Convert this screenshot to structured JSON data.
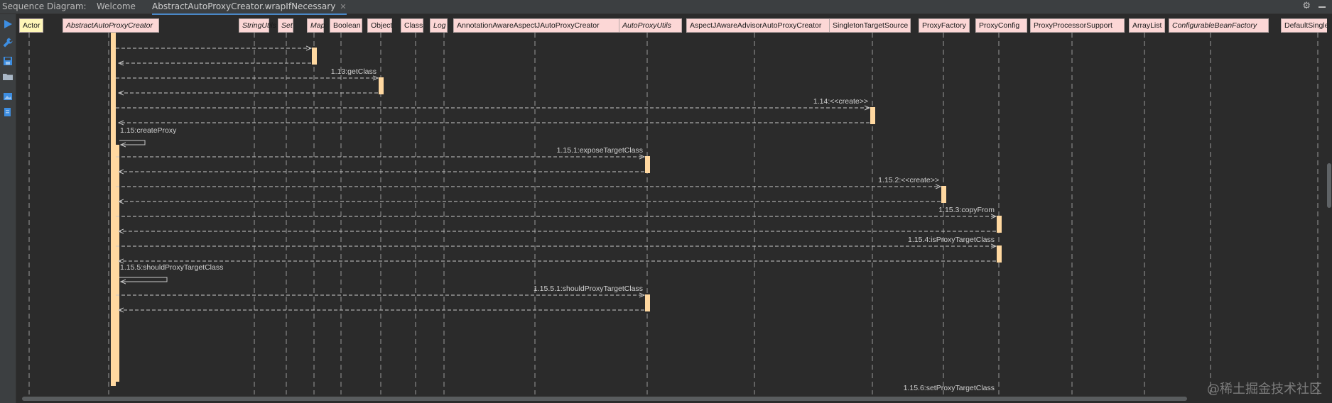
{
  "window": {
    "panel_title": "Sequence Diagram:",
    "tabs": [
      {
        "label": "Welcome",
        "active": false
      },
      {
        "label": "AbstractAutoProxyCreator.wrapIfNecessary",
        "active": true
      }
    ]
  },
  "toolbar_icons": [
    "play-icon",
    "wrench-icon",
    "save-icon",
    "folder-icon",
    "image-icon",
    "export-icon"
  ],
  "colors": {
    "background": "#2b2b2b",
    "lifeline_head": "#fcd7d6",
    "actor_head": "#fff7b8",
    "activation": "#ffd8a0",
    "tab_accent": "#4a88c7"
  },
  "lifelines": [
    {
      "name": "Actor",
      "italic": false
    },
    {
      "name": "AbstractAutoProxyCreator",
      "italic": true
    },
    {
      "name": "StringUtils",
      "italic": true
    },
    {
      "name": "Set",
      "italic": true
    },
    {
      "name": "Map",
      "italic": true
    },
    {
      "name": "Boolean",
      "italic": false
    },
    {
      "name": "Object",
      "italic": false
    },
    {
      "name": "Class",
      "italic": false
    },
    {
      "name": "Log",
      "italic": true
    },
    {
      "name": "AnnotationAwareAspectJAutoProxyCreator",
      "italic": false
    },
    {
      "name": "AutoProxyUtils",
      "italic": true
    },
    {
      "name": "AspectJAwareAdvisorAutoProxyCreator",
      "italic": false
    },
    {
      "name": "SingletonTargetSource",
      "italic": false
    },
    {
      "name": "ProxyFactory",
      "italic": false
    },
    {
      "name": "ProxyConfig",
      "italic": false
    },
    {
      "name": "ProxyProcessorSupport",
      "italic": false
    },
    {
      "name": "ArrayList",
      "italic": false
    },
    {
      "name": "ConfigurableBeanFactory",
      "italic": true
    },
    {
      "name": "DefaultSingle",
      "italic": false
    }
  ],
  "messages": [
    {
      "label": "",
      "from": "AbstractAutoProxyCreator",
      "to": "Map",
      "kind": "call"
    },
    {
      "label": "",
      "from": "Map",
      "to": "AbstractAutoProxyCreator",
      "kind": "return"
    },
    {
      "label": "1.13:getClass",
      "from": "AbstractAutoProxyCreator",
      "to": "Object",
      "kind": "call"
    },
    {
      "label": "",
      "from": "Object",
      "to": "AbstractAutoProxyCreator",
      "kind": "return"
    },
    {
      "label": "1.14:<<create>>",
      "from": "AbstractAutoProxyCreator",
      "to": "SingletonTargetSource",
      "kind": "call"
    },
    {
      "label": "",
      "from": "SingletonTargetSource",
      "to": "AbstractAutoProxyCreator",
      "kind": "return"
    },
    {
      "label": "1.15:createProxy",
      "from": "AbstractAutoProxyCreator",
      "to": "AbstractAutoProxyCreator",
      "kind": "self"
    },
    {
      "label": "1.15.1:exposeTargetClass",
      "from": "AbstractAutoProxyCreator",
      "to": "AutoProxyUtils",
      "kind": "call"
    },
    {
      "label": "",
      "from": "AutoProxyUtils",
      "to": "AbstractAutoProxyCreator",
      "kind": "return"
    },
    {
      "label": "1.15.2:<<create>>",
      "from": "AbstractAutoProxyCreator",
      "to": "ProxyFactory",
      "kind": "call"
    },
    {
      "label": "",
      "from": "ProxyFactory",
      "to": "AbstractAutoProxyCreator",
      "kind": "return"
    },
    {
      "label": "1.15.3:copyFrom",
      "from": "AbstractAutoProxyCreator",
      "to": "ProxyConfig",
      "kind": "call"
    },
    {
      "label": "",
      "from": "ProxyConfig",
      "to": "AbstractAutoProxyCreator",
      "kind": "return"
    },
    {
      "label": "1.15.4:isProxyTargetClass",
      "from": "AbstractAutoProxyCreator",
      "to": "ProxyConfig",
      "kind": "call"
    },
    {
      "label": "",
      "from": "ProxyConfig",
      "to": "AbstractAutoProxyCreator",
      "kind": "return"
    },
    {
      "label": "1.15.5:shouldProxyTargetClass",
      "from": "AbstractAutoProxyCreator",
      "to": "AbstractAutoProxyCreator",
      "kind": "self"
    },
    {
      "label": "1.15.5.1:shouldProxyTargetClass",
      "from": "AbstractAutoProxyCreator",
      "to": "AutoProxyUtils",
      "kind": "call"
    },
    {
      "label": "",
      "from": "AutoProxyUtils",
      "to": "AbstractAutoProxyCreator",
      "kind": "return"
    },
    {
      "label": "1.15.6:setProxyTargetClass",
      "from": "AbstractAutoProxyCreator",
      "to": "ProxyConfig",
      "kind": "call"
    }
  ],
  "watermark": "@稀土掘金技术社区"
}
